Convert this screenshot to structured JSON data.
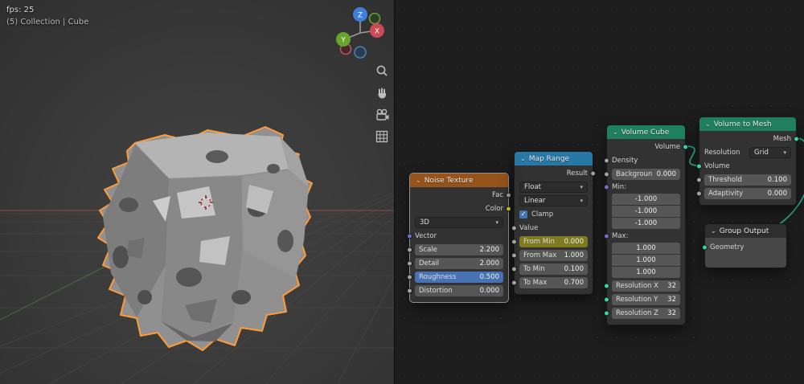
{
  "viewport": {
    "fps": "fps: 25",
    "collection_label": "(5) Collection | Cube",
    "gizmo": {
      "x": "X",
      "y": "Y",
      "z": "Z"
    }
  },
  "editor": {
    "noise": {
      "title": "Noise Texture",
      "out_fac": "Fac",
      "out_color": "Color",
      "dimensions": "3D",
      "in_vector": "Vector",
      "scale": {
        "label": "Scale",
        "value": "2.200"
      },
      "detail": {
        "label": "Detail",
        "value": "2.000"
      },
      "roughness": {
        "label": "Roughness",
        "value": "0.500"
      },
      "distortion": {
        "label": "Distortion",
        "value": "0.000"
      }
    },
    "map_range": {
      "title": "Map Range",
      "out_result": "Result",
      "data_type": "Float",
      "interpolation": "Linear",
      "clamp_label": "Clamp",
      "in_value": "Value",
      "from_min": {
        "label": "From Min",
        "value": "0.000"
      },
      "from_max": {
        "label": "From Max",
        "value": "1.000"
      },
      "to_min": {
        "label": "To Min",
        "value": "0.100"
      },
      "to_max": {
        "label": "To Max",
        "value": "0.700"
      }
    },
    "volume_cube": {
      "title": "Volume Cube",
      "out_volume": "Volume",
      "in_density": "Density",
      "background": {
        "label": "Backgroun",
        "value": "0.000"
      },
      "min_label": "Min:",
      "min": [
        "-1.000",
        "-1.000",
        "-1.000"
      ],
      "max_label": "Max:",
      "max": [
        "1.000",
        "1.000",
        "1.000"
      ],
      "res_x": {
        "label": "Resolution X",
        "value": "32"
      },
      "res_y": {
        "label": "Resolution Y",
        "value": "32"
      },
      "res_z": {
        "label": "Resolution Z",
        "value": "32"
      }
    },
    "volume_to_mesh": {
      "title": "Volume to Mesh",
      "out_mesh": "Mesh",
      "resolution_label": "Resolution",
      "resolution_mode": "Grid",
      "in_volume": "Volume",
      "threshold": {
        "label": "Threshold",
        "value": "0.100"
      },
      "adaptivity": {
        "label": "Adaptivity",
        "value": "0.000"
      }
    },
    "group_output": {
      "title": "Group Output",
      "in_geometry": "Geometry"
    }
  },
  "colors": {
    "noise_header": "#96541b",
    "map_range_header": "#2878a5",
    "volume_header": "#1f7f5f",
    "group_output_header": "#2e2e2e",
    "accent_blue": "#4772b3",
    "highlight_olive": "#7d7a20",
    "socket_gray": "#a1a1a1",
    "socket_yellow": "#c9c92e",
    "socket_vector": "#7070c8",
    "socket_geometry_teal": "#35d6a7",
    "selection_outline": "#ff9b38"
  }
}
